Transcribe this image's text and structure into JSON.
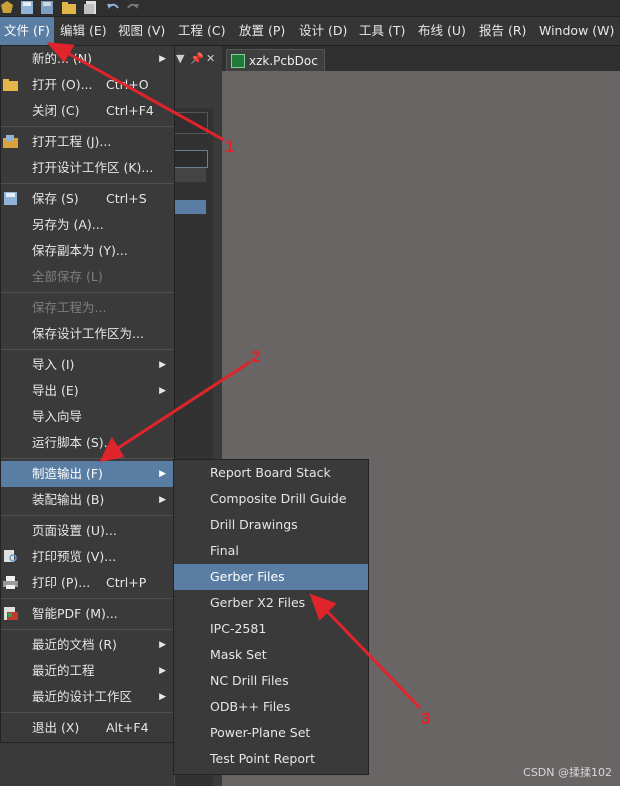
{
  "menubar": {
    "items": [
      {
        "label": "文件 (F)"
      },
      {
        "label": "编辑 (E)"
      },
      {
        "label": "视图 (V)"
      },
      {
        "label": "工程 (C)"
      },
      {
        "label": "放置 (P)"
      },
      {
        "label": "设计 (D)"
      },
      {
        "label": "工具 (T)"
      },
      {
        "label": "布线 (U)"
      },
      {
        "label": "报告 (R)"
      },
      {
        "label": "Window (W)"
      }
    ]
  },
  "doc_tab": {
    "label": "xzk.PcbDoc"
  },
  "file_menu": {
    "items": [
      {
        "label": "新的... (N)",
        "shortcut": "",
        "submenu": true,
        "disabled": false
      },
      {
        "label": "打开 (O)...",
        "shortcut": "Ctrl+O",
        "submenu": false,
        "disabled": false
      },
      {
        "label": "关闭 (C)",
        "shortcut": "Ctrl+F4",
        "submenu": false,
        "disabled": false
      },
      {
        "label": "打开工程 (J)...",
        "shortcut": "",
        "submenu": false,
        "disabled": false
      },
      {
        "label": "打开设计工作区 (K)...",
        "shortcut": "",
        "submenu": false,
        "disabled": false
      },
      {
        "label": "保存 (S)",
        "shortcut": "Ctrl+S",
        "submenu": false,
        "disabled": false
      },
      {
        "label": "另存为 (A)...",
        "shortcut": "",
        "submenu": false,
        "disabled": false
      },
      {
        "label": "保存副本为 (Y)...",
        "shortcut": "",
        "submenu": false,
        "disabled": false
      },
      {
        "label": "全部保存 (L)",
        "shortcut": "",
        "submenu": false,
        "disabled": true
      },
      {
        "label": "保存工程为...",
        "shortcut": "",
        "submenu": false,
        "disabled": true
      },
      {
        "label": "保存设计工作区为...",
        "shortcut": "",
        "submenu": false,
        "disabled": false
      },
      {
        "label": "导入 (I)",
        "shortcut": "",
        "submenu": true,
        "disabled": false
      },
      {
        "label": "导出 (E)",
        "shortcut": "",
        "submenu": true,
        "disabled": false
      },
      {
        "label": "导入向导",
        "shortcut": "",
        "submenu": false,
        "disabled": false
      },
      {
        "label": "运行脚本 (S)...",
        "shortcut": "",
        "submenu": false,
        "disabled": false
      },
      {
        "label": "制造输出 (F)",
        "shortcut": "",
        "submenu": true,
        "disabled": false
      },
      {
        "label": "装配输出 (B)",
        "shortcut": "",
        "submenu": true,
        "disabled": false
      },
      {
        "label": "页面设置 (U)...",
        "shortcut": "",
        "submenu": false,
        "disabled": false
      },
      {
        "label": "打印预览 (V)...",
        "shortcut": "",
        "submenu": false,
        "disabled": false
      },
      {
        "label": "打印 (P)...",
        "shortcut": "Ctrl+P",
        "submenu": false,
        "disabled": false
      },
      {
        "label": "智能PDF (M)...",
        "shortcut": "",
        "submenu": false,
        "disabled": false
      },
      {
        "label": "最近的文档 (R)",
        "shortcut": "",
        "submenu": true,
        "disabled": false
      },
      {
        "label": "最近的工程",
        "shortcut": "",
        "submenu": true,
        "disabled": false
      },
      {
        "label": "最近的设计工作区",
        "shortcut": "",
        "submenu": true,
        "disabled": false
      },
      {
        "label": "退出 (X)",
        "shortcut": "Alt+F4",
        "submenu": false,
        "disabled": false
      }
    ]
  },
  "fab_submenu": {
    "items": [
      {
        "label": "Report Board Stack"
      },
      {
        "label": "Composite Drill Guide"
      },
      {
        "label": "Drill Drawings"
      },
      {
        "label": "Final"
      },
      {
        "label": "Gerber Files"
      },
      {
        "label": "Gerber X2 Files"
      },
      {
        "label": "IPC-2581"
      },
      {
        "label": "Mask Set"
      },
      {
        "label": "NC Drill Files"
      },
      {
        "label": "ODB++ Files"
      },
      {
        "label": "Power-Plane Set"
      },
      {
        "label": "Test Point Report"
      }
    ]
  },
  "annotations": {
    "n1": "1",
    "n2": "2",
    "n3": "3"
  },
  "watermark": "CSDN @揉揉102",
  "colors": {
    "highlight": "#5a7ea3",
    "arrow": "#e0242b",
    "canvas": "#6a6565"
  }
}
